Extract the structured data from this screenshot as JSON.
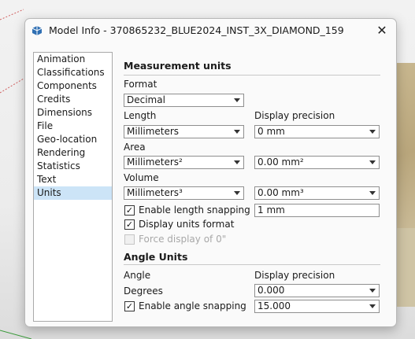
{
  "window": {
    "title": "Model Info - 370865232_BLUE2024_INST_3X_DIAMOND_159",
    "app_icon": "sketchup-icon",
    "close_icon": "close-icon",
    "close_glyph": "✕"
  },
  "sidebar": {
    "items": [
      {
        "label": "Animation"
      },
      {
        "label": "Classifications"
      },
      {
        "label": "Components"
      },
      {
        "label": "Credits"
      },
      {
        "label": "Dimensions"
      },
      {
        "label": "File"
      },
      {
        "label": "Geo-location"
      },
      {
        "label": "Rendering"
      },
      {
        "label": "Statistics"
      },
      {
        "label": "Text"
      },
      {
        "label": "Units",
        "selected": true
      }
    ]
  },
  "units": {
    "measurement_title": "Measurement units",
    "format_label": "Format",
    "format_value": "Decimal",
    "length_label": "Length",
    "length_value": "Millimeters",
    "display_precision_label": "Display precision",
    "length_precision": "0 mm",
    "area_label": "Area",
    "area_value": "Millimeters²",
    "area_precision": "0.00 mm²",
    "volume_label": "Volume",
    "volume_value": "Millimeters³",
    "volume_precision": "0.00 mm³",
    "length_snapping_label": "Enable length snapping",
    "length_snapping_checked": true,
    "length_snapping_value": "1 mm",
    "display_units_label": "Display units format",
    "display_units_checked": true,
    "force_display_label": "Force display of 0\"",
    "force_display_checked": false,
    "force_display_enabled": false,
    "angle_title": "Angle Units",
    "angle_label": "Angle",
    "angle_precision_label": "Display precision",
    "angle_unit": "Degrees",
    "angle_precision": "0.000",
    "angle_snapping_label": "Enable angle snapping",
    "angle_snapping_checked": true,
    "angle_snapping_value": "15.000"
  },
  "glyphs": {
    "check": "✓"
  }
}
